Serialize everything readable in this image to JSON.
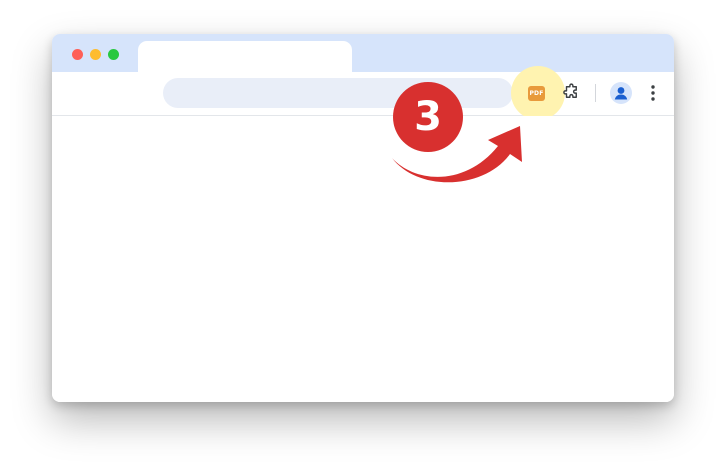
{
  "colors": {
    "frame_bg": "#d6e4fb",
    "omnibox_bg": "#e9eef8",
    "highlight": "#fff3b0",
    "pdf_icon": "#e89a3c",
    "accent_red": "#d8302f",
    "profile_blue": "#1a5fd0"
  },
  "window": {
    "controls": [
      {
        "name": "close",
        "color": "#fe5f57"
      },
      {
        "name": "minimize",
        "color": "#febc2e"
      },
      {
        "name": "zoom",
        "color": "#28c840"
      }
    ]
  },
  "toolbar": {
    "omnibox_value": "",
    "pdf_extension": {
      "icon": "pdf-icon",
      "label": "PDF"
    },
    "extensions_icon": "puzzle-icon",
    "profile_icon": "person-icon",
    "menu_icon": "kebab-menu-icon"
  },
  "annotation": {
    "step_number": "3",
    "arrow_icon": "curved-arrow-icon"
  }
}
